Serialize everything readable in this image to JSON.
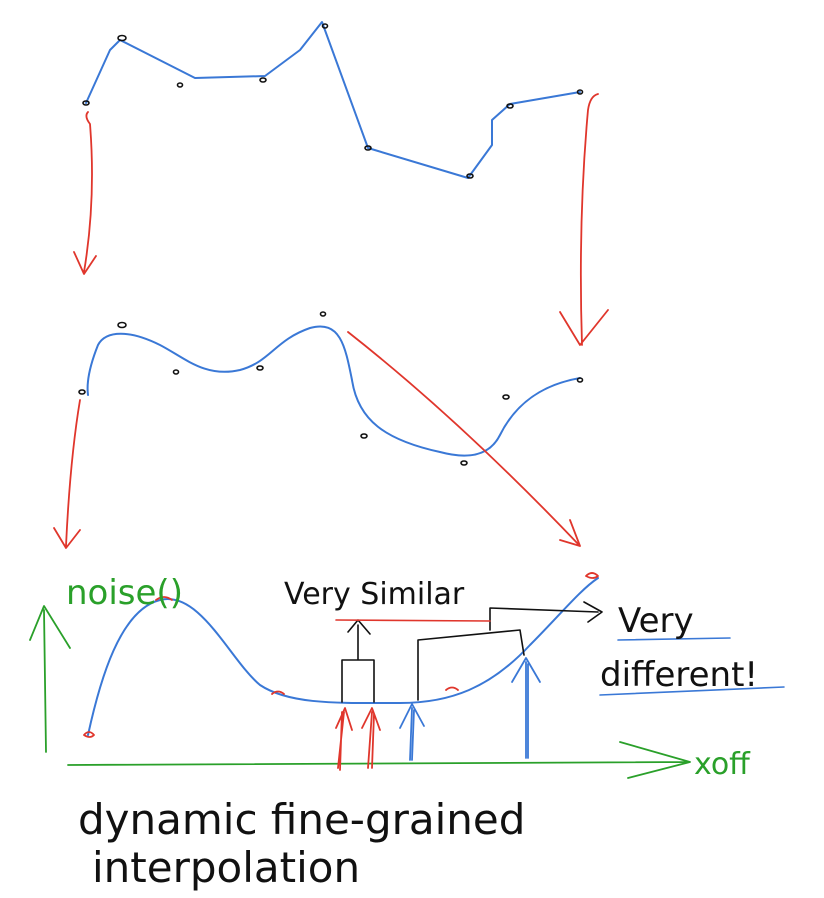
{
  "labels": {
    "noise": "noise()",
    "very_similar": "Very Similar",
    "very_different_line1": "Very",
    "very_different_line2": "different!",
    "xoff": "xoff",
    "caption_line1": "dynamic fine-grained",
    "caption_line2": "interpolation"
  },
  "colors": {
    "curve": "#3a78d6",
    "arrow": "#e0362c",
    "axis": "#2aa02a",
    "ink": "#111111"
  }
}
